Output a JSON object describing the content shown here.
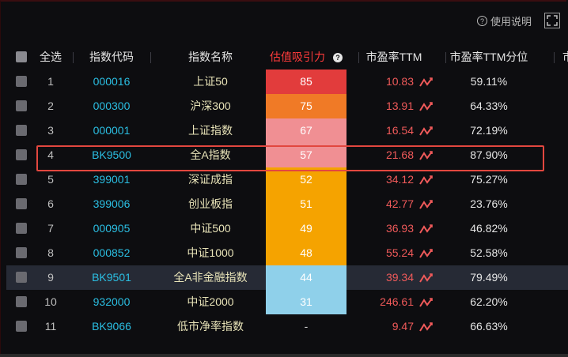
{
  "toolbar": {
    "help_label": "使用说明",
    "help_icon": "question-circle-icon",
    "fullscreen_icon": "fullscreen-icon"
  },
  "header": {
    "select_all": "全选",
    "code": "指数代码",
    "name": "指数名称",
    "score": "估值吸引力",
    "pe": "市盈率TTM",
    "pe_pct": "市盈率TTM分位",
    "more": "市"
  },
  "colors": {
    "score_red": "#e23c3c",
    "score_orange": "#f07a26",
    "score_pink": "#f08f93",
    "score_amber": "#f5a300",
    "score_blue": "#8fd0ea",
    "highlight": "#e2473f",
    "code": "#2bbfe3",
    "pe": "#f05a5a"
  },
  "rows": [
    {
      "idx": "1",
      "code": "000016",
      "name": "上证50",
      "score": "85",
      "score_color": "#e23c3c",
      "pe": "10.83",
      "pct": "59.11%"
    },
    {
      "idx": "2",
      "code": "000300",
      "name": "沪深300",
      "score": "75",
      "score_color": "#f07a26",
      "pe": "13.91",
      "pct": "64.33%"
    },
    {
      "idx": "3",
      "code": "000001",
      "name": "上证指数",
      "score": "67",
      "score_color": "#f08f93",
      "pe": "16.54",
      "pct": "72.19%"
    },
    {
      "idx": "4",
      "code": "BK9500",
      "name": "全A指数",
      "score": "57",
      "score_color": "#f08f93",
      "pe": "21.68",
      "pct": "87.90%"
    },
    {
      "idx": "5",
      "code": "399001",
      "name": "深证成指",
      "score": "52",
      "score_color": "#f5a300",
      "pe": "34.12",
      "pct": "75.27%"
    },
    {
      "idx": "6",
      "code": "399006",
      "name": "创业板指",
      "score": "51",
      "score_color": "#f5a300",
      "pe": "42.77",
      "pct": "23.76%"
    },
    {
      "idx": "7",
      "code": "000905",
      "name": "中证500",
      "score": "49",
      "score_color": "#f5a300",
      "pe": "36.93",
      "pct": "46.82%"
    },
    {
      "idx": "8",
      "code": "000852",
      "name": "中证1000",
      "score": "48",
      "score_color": "#f5a300",
      "pe": "55.24",
      "pct": "52.58%"
    },
    {
      "idx": "9",
      "code": "BK9501",
      "name": "全A非金融指数",
      "score": "44",
      "score_color": "#8fd0ea",
      "pe": "39.34",
      "pct": "79.49%"
    },
    {
      "idx": "10",
      "code": "932000",
      "name": "中证2000",
      "score": "31",
      "score_color": "#8fd0ea",
      "pe": "246.61",
      "pct": "62.20%"
    },
    {
      "idx": "11",
      "code": "BK9066",
      "name": "低市净率指数",
      "score": "-",
      "score_color": "",
      "pe": "9.47",
      "pct": "66.63%"
    }
  ]
}
